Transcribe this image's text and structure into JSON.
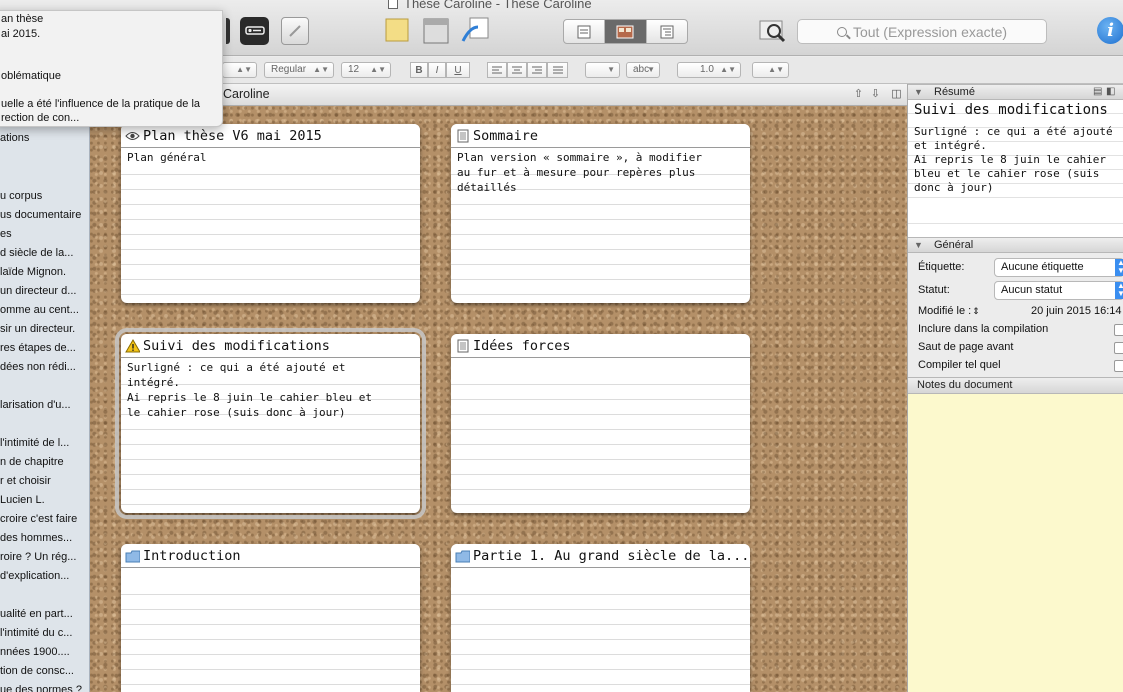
{
  "window": {
    "title": "Thèse Caroline - Thèse Caroline"
  },
  "toolbar": {
    "search_placeholder": "Tout (Expression exacte)",
    "info_label": "i"
  },
  "format_bar": {
    "font_style": "Regular",
    "font_size": "12",
    "bold": "B",
    "italic": "I",
    "underline": "U",
    "highlight_label": "abc",
    "line_spacing": "1.0"
  },
  "popover": {
    "lines": [
      "an thèse",
      "ai 2015.",
      "oblématique",
      "uelle a été l'influence de la pratique de la",
      "rection de con..."
    ]
  },
  "binder": {
    "items": [
      "ations",
      "u corpus",
      "us documentaire",
      "es",
      "d siècle de la...",
      "laïde Mignon.",
      "un directeur d...",
      "omme au cent...",
      "sir un directeur.",
      "res étapes de...",
      "dées non rédi...",
      "larisation d'u...",
      "l'intimité de l...",
      "n de chapitre",
      "r et choisir",
      "Lucien L.",
      "croire c'est faire",
      "des hommes...",
      "roire ? Un rég...",
      "d'explication...",
      "ualité en part...",
      "l'intimité du c...",
      "nnées 1900....",
      "tion de consc...",
      "ue des normes ?"
    ]
  },
  "corkboard": {
    "title": "Caroline",
    "cards": [
      {
        "title": "Plan thèse V6 mai 2015",
        "icon": "eye-icon",
        "body": "Plan général"
      },
      {
        "title": "Sommaire",
        "icon": "document-icon",
        "body": "Plan version « sommaire », à modifier\nau fur et à mesure pour repères plus\ndétaillés"
      },
      {
        "title": "Suivi des modifications",
        "icon": "warning-icon",
        "body": "Surligné : ce qui a été ajouté et\nintégré.\nAi repris le 8 juin le cahier bleu et\nle cahier rose (suis donc à jour)"
      },
      {
        "title": "Idées forces",
        "icon": "document-icon",
        "body": ""
      },
      {
        "title": "Introduction",
        "icon": "folder-icon",
        "body": ""
      },
      {
        "title": "Partie 1. Au grand siècle de la...",
        "icon": "folder-icon",
        "body": ""
      }
    ]
  },
  "inspector": {
    "synopsis_header": "Résumé",
    "synopsis_title": "Suivi des modifications",
    "synopsis_text": "Surligné : ce qui a été ajouté\net intégré.\nAi repris le 8 juin le cahier\nbleu et le cahier rose (suis\ndonc à jour)",
    "general_header": "Général",
    "label_caption": "Étiquette:",
    "label_value": "Aucune étiquette",
    "status_caption": "Statut:",
    "status_value": "Aucun statut",
    "modified_caption": "Modifié le :",
    "modified_value": "20 juin 2015 16:14",
    "include_compile": "Inclure dans la compilation",
    "page_break": "Saut de page avant",
    "compile_as_is": "Compiler tel quel",
    "notes_header": "Notes du document"
  },
  "colors": {
    "cork": "#b49068",
    "notes": "#fcf9cd",
    "accent": "#3a8ef0"
  }
}
